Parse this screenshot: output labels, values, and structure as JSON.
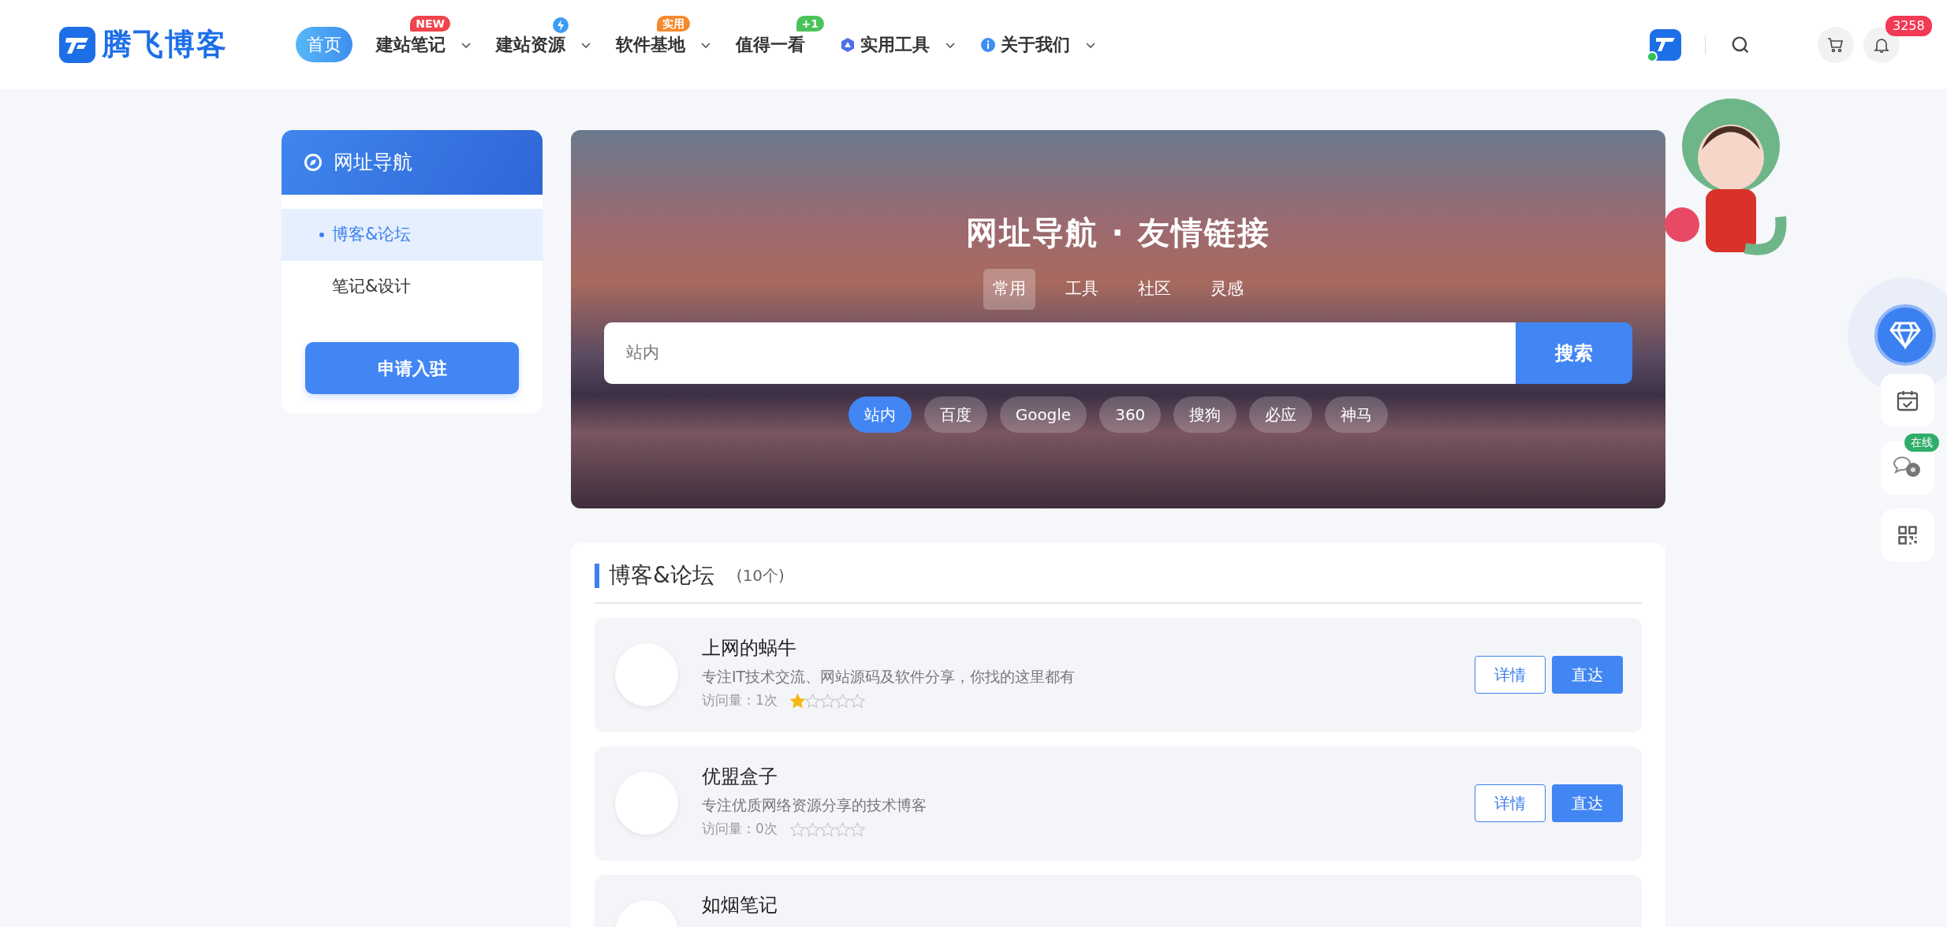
{
  "header": {
    "logo": "腾飞博客",
    "nav": [
      {
        "label": "首页",
        "selected": true,
        "dropdown": false
      },
      {
        "label": "建站笔记",
        "selected": false,
        "dropdown": true,
        "badge": {
          "kind": "text",
          "text": "NEW",
          "color": "#f0434b"
        }
      },
      {
        "label": "建站资源",
        "selected": false,
        "dropdown": true,
        "badge": {
          "kind": "bolt",
          "color": "#3c9cf2"
        }
      },
      {
        "label": "软件基地",
        "selected": false,
        "dropdown": true,
        "badge": {
          "kind": "text",
          "text": "实用",
          "color": "#f58a2c"
        }
      },
      {
        "label": "值得一看",
        "selected": false,
        "dropdown": false,
        "badge": {
          "kind": "text",
          "text": "+1",
          "color": "#4cc35a"
        }
      },
      {
        "label": "实用工具",
        "selected": false,
        "dropdown": true,
        "kind": "hexagon"
      },
      {
        "label": "关于我们",
        "selected": false,
        "dropdown": true,
        "kind": "info"
      }
    ],
    "user_online": true,
    "notifications": "3258"
  },
  "sidebar": {
    "title": "网址导航",
    "items": [
      {
        "label": "博客&论坛",
        "selected": true
      },
      {
        "label": "笔记&设计",
        "selected": false
      }
    ],
    "button": "申请入驻"
  },
  "banner": {
    "title": "网址导航 · 友情链接",
    "tabs": [
      {
        "label": "常用",
        "selected": true
      },
      {
        "label": "工具",
        "selected": false
      },
      {
        "label": "社区",
        "selected": false
      },
      {
        "label": "灵感",
        "selected": false
      }
    ],
    "search": {
      "placeholder": "站内",
      "button": "搜索"
    },
    "engines": [
      {
        "label": "站内",
        "selected": true
      },
      {
        "label": "百度",
        "selected": false
      },
      {
        "label": "Google",
        "selected": false
      },
      {
        "label": "360",
        "selected": false
      },
      {
        "label": "搜狗",
        "selected": false
      },
      {
        "label": "必应",
        "selected": false
      },
      {
        "label": "神马",
        "selected": false
      }
    ]
  },
  "section": {
    "title": "博客&论坛",
    "count": "(10个)",
    "sites": [
      {
        "name": "上网的蜗牛",
        "description": "专注IT技术交流、网站源码及软件分享，你找的这里都有",
        "visits": "访问量：1次",
        "stars": 1,
        "details": "详情",
        "go": "直达"
      },
      {
        "name": "优盟盒子",
        "description": "专注优质网络资源分享的技术博客",
        "visits": "访问量：0次",
        "stars": 0,
        "details": "详情",
        "go": "直达"
      },
      {
        "name": "如烟笔记"
      }
    ]
  },
  "float": {
    "online": "在线"
  }
}
